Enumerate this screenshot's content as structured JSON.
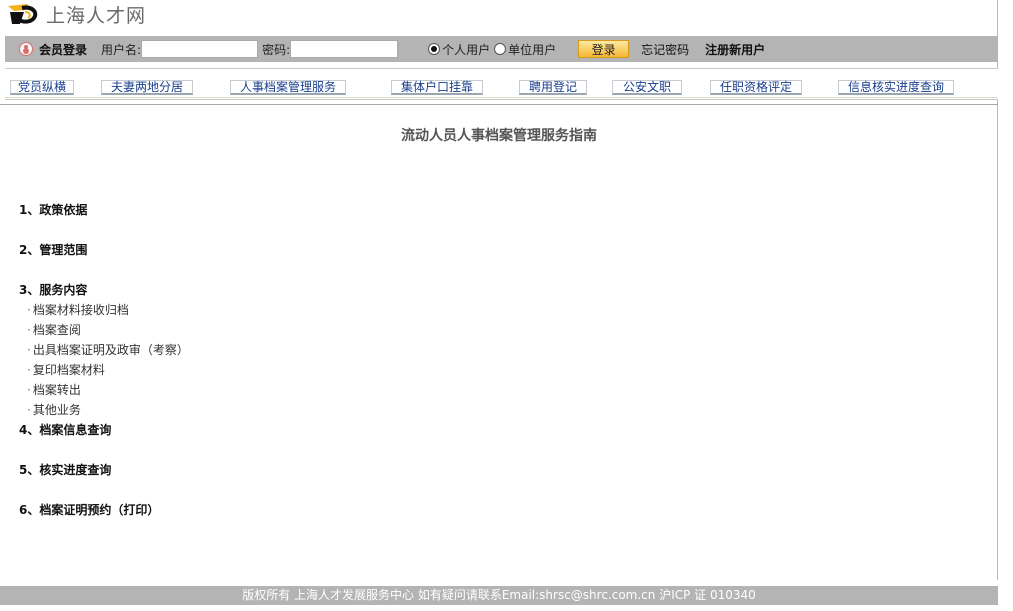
{
  "header": {
    "site_name": "上海人才网"
  },
  "login": {
    "title": "会员登录",
    "username_label": "用户名:",
    "username_value": "",
    "password_label": "密码:",
    "password_value": "",
    "radio_personal": "个人用户",
    "radio_company": "单位用户",
    "selected_user_type": "个人用户",
    "login_button": "登录",
    "forgot_password": "忘记密码",
    "register": "注册新用户"
  },
  "nav": {
    "items": [
      "党员纵横",
      "夫妻两地分居",
      "人事档案管理服务",
      "集体户口挂靠",
      "聘用登记",
      "公安文职",
      "任职资格评定",
      "信息核实进度查询"
    ]
  },
  "content": {
    "title": "流动人员人事档案管理服务指南",
    "sections": [
      {
        "label": "1、政策依据"
      },
      {
        "label": "2、管理范围"
      },
      {
        "label": "3、服务内容",
        "subitems": [
          "档案材料接收归档",
          "档案查阅",
          "出具档案证明及政审（考察）",
          "复印档案材料",
          "档案转出",
          "其他业务"
        ]
      },
      {
        "label": "4、档案信息查询"
      },
      {
        "label": "5、核实进度查询"
      },
      {
        "label": "6、档案证明预约（打印）"
      }
    ]
  },
  "footer": {
    "text": "版权所有 上海人才发展服务中心 如有疑问请联系Email:shrsc@shrc.com.cn  沪ICP 证 010340"
  },
  "colors": {
    "bar_gray": "#b4b4b4",
    "nav_text": "#1a3f8f",
    "login_button": "#f5b733"
  }
}
